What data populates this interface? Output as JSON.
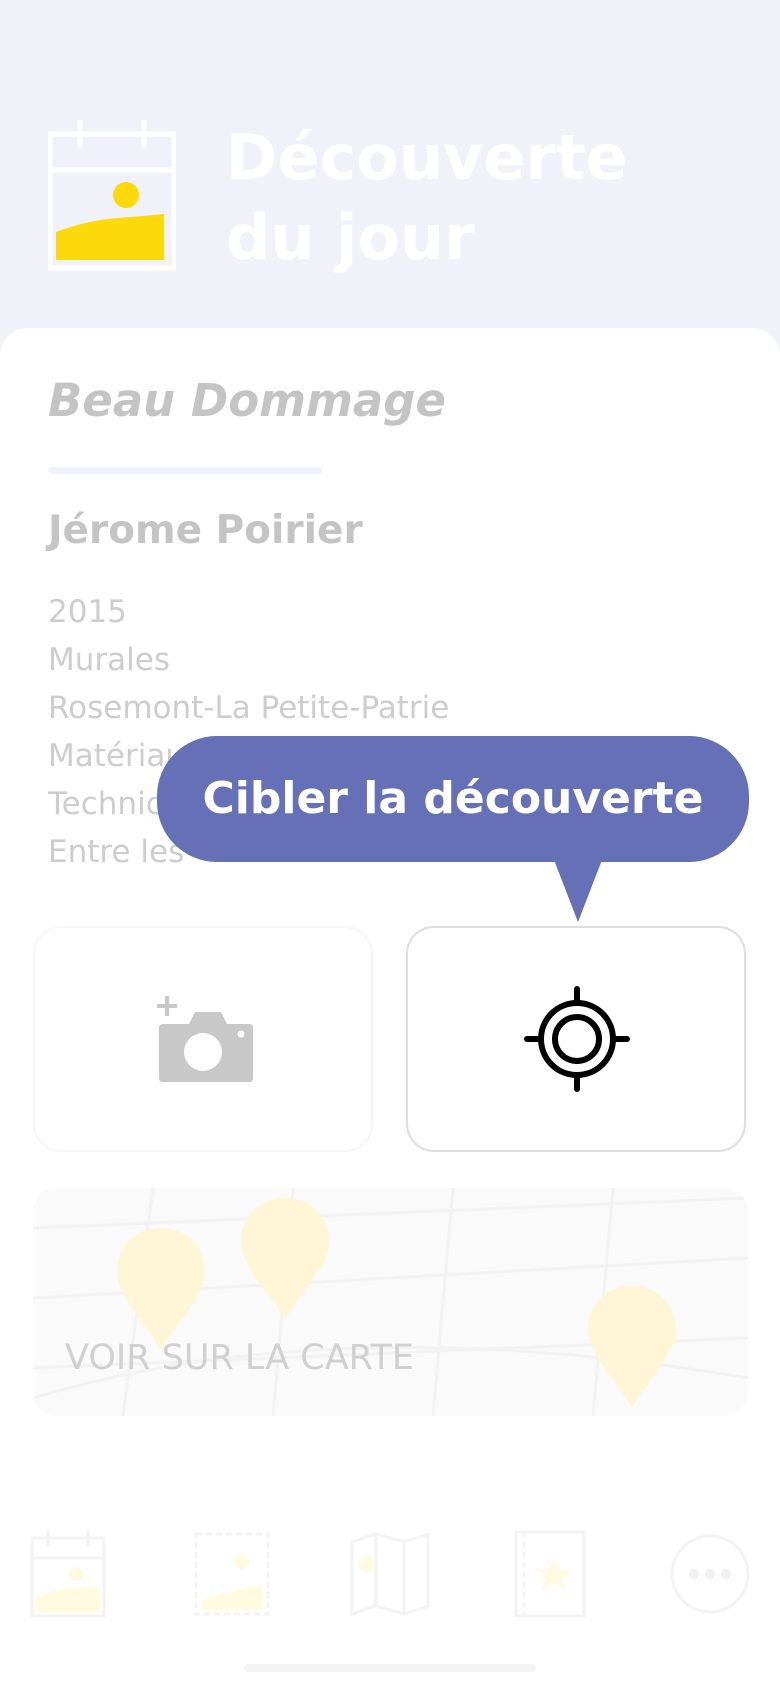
{
  "header": {
    "title_line1": "Découverte",
    "title_line2": "du jour",
    "icon": "calendar-image-icon"
  },
  "artwork": {
    "title": "Beau Dommage",
    "artist": "Jérome Poirier",
    "details": [
      "2015",
      "Murales",
      "Rosemont-La Petite-Patrie",
      "Matériau",
      "Technic",
      "Entre les"
    ]
  },
  "tooltip": {
    "text": "Cibler la découverte"
  },
  "actions": {
    "photo_icon": "add-camera-icon",
    "target_icon": "crosshair-target-icon"
  },
  "map": {
    "label": "VOIR SUR LA CARTE"
  },
  "nav": {
    "items": [
      "calendar-image-icon",
      "gallery-icon",
      "map-icon",
      "favorites-book-icon",
      "more-icon"
    ]
  },
  "colors": {
    "accent": "#6570b7",
    "yellow": "#fcd90a",
    "background": "#f1f2f9"
  }
}
